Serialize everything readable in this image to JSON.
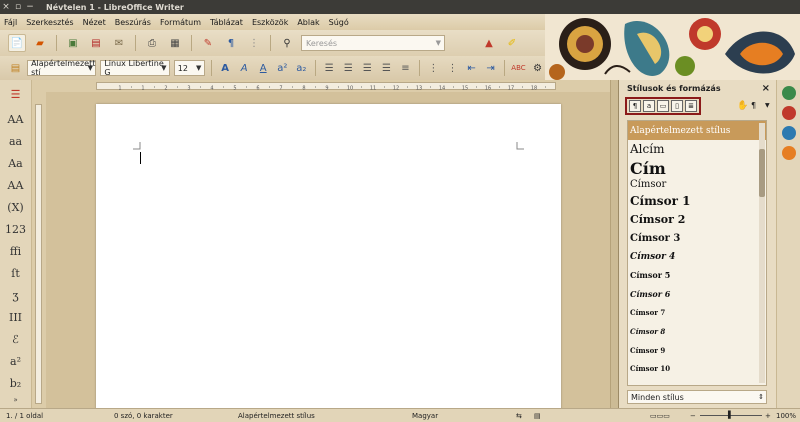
{
  "window": {
    "title": "Névtelen 1 - LibreOffice Writer",
    "buttons": [
      "×",
      "▫",
      "−"
    ]
  },
  "menu": [
    "Fájl",
    "Szerkesztés",
    "Nézet",
    "Beszúrás",
    "Formátum",
    "Táblázat",
    "Eszközök",
    "Ablak",
    "Súgó"
  ],
  "toolbar1": {
    "search_placeholder": "Keresés"
  },
  "toolbar2": {
    "paragraph_style": "Alapértelmezett stí",
    "font_name": "Linux Libertine G",
    "font_size": "12"
  },
  "ruler": {
    "ticks": [
      "1",
      "1",
      "2",
      "3",
      "4",
      "5",
      "6",
      "7",
      "8",
      "9",
      "10",
      "11",
      "12",
      "13",
      "14",
      "15",
      "16",
      "17",
      "18"
    ]
  },
  "left_sidebar": {
    "chars": [
      "AA",
      "aa",
      "Aa",
      "AA",
      "(X)",
      "123",
      "ffi",
      "ſt",
      "ʒ",
      "III",
      "ℰ",
      "a²",
      "b₂"
    ]
  },
  "styles_panel": {
    "title": "Stílusok és formázás",
    "close": "×",
    "styles": [
      {
        "name": "Alapértelmezett stílus",
        "selected": true
      },
      {
        "name": "Alcím"
      },
      {
        "name": "Cím"
      },
      {
        "name": "Címsor"
      },
      {
        "name": "Címsor 1"
      },
      {
        "name": "Címsor 2"
      },
      {
        "name": "Címsor 3"
      },
      {
        "name": "Címsor 4"
      },
      {
        "name": "Címsor 5"
      },
      {
        "name": "Címsor 6"
      },
      {
        "name": "Címsor 7"
      },
      {
        "name": "Címsor 8"
      },
      {
        "name": "Címsor 9"
      },
      {
        "name": "Címsor 10"
      }
    ],
    "filter": "Minden stílus"
  },
  "statusbar": {
    "page": "1. / 1 oldal",
    "words": "0 szó, 0 karakter",
    "style": "Alapértelmezett stílus",
    "language": "Magyar",
    "zoom": "100%"
  },
  "colors": {
    "titlebar": "#3c3b37",
    "accent_selected": "#c89a5a",
    "highlight_border": "#8b1a1a"
  }
}
